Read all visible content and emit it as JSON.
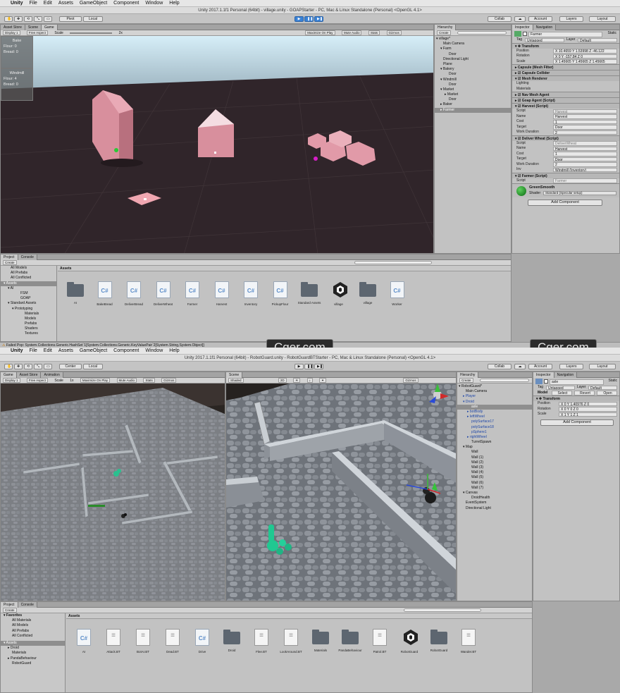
{
  "window1": {
    "menu": [
      "Unity",
      "File",
      "Edit",
      "Assets",
      "GameObject",
      "Component",
      "Window",
      "Help"
    ],
    "title": "Unity 2017.1.1f1 Personal (64bit) - village.unity - GOAPStarter - PC, Mac & Linux Standalone (Personal) <OpenGL 4.1>",
    "toolbar": {
      "pivot": "Pivot",
      "local": "Local",
      "collab": "Collab",
      "account": "Account",
      "layers": "Layers",
      "layout": "Layout"
    },
    "tabs_left": [
      "Asset Store",
      "Scene",
      "Game"
    ],
    "game_bar": [
      "Display 1",
      "Free Aspect",
      "Scale",
      "2x",
      "Maximize On Play",
      "Mute Audio",
      "Stats",
      "Gizmos"
    ],
    "overlay_bake": {
      "title": "Bake",
      "lines": [
        "Flour: 0",
        "Bread: 0"
      ]
    },
    "overlay_windmill": {
      "title": "Windmill",
      "lines": [
        "Flour: 4",
        "Bread: 0"
      ]
    },
    "hierarchy": {
      "tab": "Hierarchy",
      "create": "Create",
      "items": [
        "village*",
        "Main Camera",
        "Farm",
        "Door",
        "Directional Light",
        "Plane",
        "Bakery",
        "Door",
        "Windmill",
        "Door",
        "Market",
        "Market",
        "Door",
        "Baker",
        "Farmer"
      ]
    },
    "inspector": {
      "tabs": [
        "Inspector",
        "Navigation"
      ],
      "object_name": "Farmer",
      "static": "Static",
      "tag_label": "Tag",
      "tag": "Untagged",
      "layer_label": "Layer",
      "layer": "Default",
      "transform": {
        "header": "Transform",
        "rows": [
          {
            "k": "Position",
            "v": "X 10.4659   Y 1.53998   Z -46.122"
          },
          {
            "k": "Rotation",
            "v": "X 0   Y -157.84   Z 0"
          },
          {
            "k": "Scale",
            "v": "X 1.45665   Y 1.45665   Z 1.45665"
          }
        ]
      },
      "components": [
        "Capsule (Mesh Filter)",
        "Capsule Collider",
        "Mesh Renderer",
        "Lighting",
        "Materials",
        "Nav Mesh Agent",
        "Goap Agent (Script)"
      ],
      "harvest": {
        "header": "Harvest (Script)",
        "rows": [
          {
            "k": "Script",
            "v": "Harvest"
          },
          {
            "k": "Name",
            "v": "Harvest"
          },
          {
            "k": "Cost",
            "v": "1"
          },
          {
            "k": "Target",
            "v": "Door"
          },
          {
            "k": "Work Duration",
            "v": "2"
          }
        ]
      },
      "deliver": {
        "header": "Deliver Wheat (Script)",
        "rows": [
          {
            "k": "Script",
            "v": "DeliverWheat"
          },
          {
            "k": "Name",
            "v": "Harvest"
          },
          {
            "k": "Cost",
            "v": "1"
          },
          {
            "k": "Target",
            "v": "Door"
          },
          {
            "k": "Work Duration",
            "v": "2"
          },
          {
            "k": "Inv",
            "v": "Windmill (Inventory)"
          }
        ]
      },
      "farmer": {
        "header": "Farmer (Script)",
        "rows": [
          {
            "k": "Script",
            "v": "Farmer"
          }
        ]
      },
      "material": {
        "name": "GreenSmooth",
        "shader_label": "Shader",
        "shader": "Standard (Specular setup)"
      },
      "add_component": "Add Component"
    },
    "project": {
      "tabs": [
        "Project",
        "Console"
      ],
      "create": "Create",
      "tree": [
        "All Models",
        "All Prefabs",
        "All Conflicted",
        "Assets",
        "AI",
        "FSM",
        "GOAP",
        "Standard Assets",
        "Prototyping",
        "Materials",
        "Models",
        "Prefabs",
        "Shaders",
        "Textures"
      ],
      "breadcrumb": "Assets",
      "assets": [
        "AI",
        "BakeBread",
        "DeliverBread",
        "DeliverWheat",
        "Farmer",
        "Harvest",
        "Inventory",
        "PickupFlour",
        "Standard Assets",
        "village",
        "village",
        "Worker"
      ]
    },
    "status": "Failed Pop: System.Collections.Generic.HashSet`1[System.Collections.Generic.KeyValuePair`2[System.String,System.Object]]",
    "watermark": [
      "Cger.com",
      "Cger.com"
    ]
  },
  "window2": {
    "menu": [
      "Unity",
      "File",
      "Edit",
      "Assets",
      "GameObject",
      "Component",
      "Window",
      "Help"
    ],
    "title": "Unity 2017.1.1f1 Personal (64bit) - RobotGuard.unity - RobotGuardBTStarter - PC, Mac & Linux Standalone (Personal) <OpenGL 4.1>",
    "toolbar": {
      "pivot": "Center",
      "local": "Local",
      "collab": "Collab",
      "account": "Account",
      "layers": "Layers",
      "layout": "Layout"
    },
    "tabs_left": [
      "Game",
      "Asset Store",
      "Animation"
    ],
    "game_bar": [
      "Display 1",
      "Free Aspect",
      "Scale",
      "1x",
      "Maximize On Play",
      "Mute Audio",
      "Stats",
      "Gizmos"
    ],
    "scene_tab": "Scene",
    "scene_bar": [
      "Shaded",
      "2D",
      "Gizmos"
    ],
    "hierarchy": {
      "tab": "Hierarchy",
      "create": "Create",
      "items": [
        "RobotGuard*",
        "Main Camera",
        "Player",
        "Droid",
        "axle",
        "botBody",
        "leftWheel",
        "polySurface17",
        "polySurface18",
        "pSphere1",
        "rightWheel",
        "TurretSpawn",
        "Map",
        "Wall",
        "Wall (1)",
        "Wall (2)",
        "Wall (3)",
        "Wall (4)",
        "Wall (5)",
        "Wall (6)",
        "Wall (7)",
        "Canvas",
        "DroidHealth",
        "EventSystem",
        "Directional Light"
      ]
    },
    "inspector": {
      "tabs": [
        "Inspector",
        "Navigation"
      ],
      "object_name": "axle",
      "static": "Static",
      "tag_label": "Tag",
      "tag": "Untagged",
      "layer_label": "Layer",
      "layer": "Default",
      "model_label": "Model",
      "model_buttons": [
        "Select",
        "Revert",
        "Open"
      ],
      "transform": {
        "header": "Transform",
        "rows": [
          {
            "k": "Position",
            "v": "X 0   Y 1.40976   Z 0"
          },
          {
            "k": "Rotation",
            "v": "X 0   Y 0   Z 0"
          },
          {
            "k": "Scale",
            "v": "X 1   Y 1   Z 1"
          }
        ]
      },
      "add_component": "Add Component"
    },
    "project": {
      "tabs": [
        "Project",
        "Console"
      ],
      "create": "Create",
      "tree": [
        "Favorites",
        "All Materials",
        "All Models",
        "All Prefabs",
        "All Conflicted",
        "Assets",
        "Droid",
        "Materials",
        "PandaBehaviour",
        "RobotGuard"
      ],
      "breadcrumb": "Assets",
      "assets": [
        "AI",
        "Attack.BT",
        "BotAI.BT",
        "Dead.BT",
        "Drive",
        "Droid",
        "Flee.BT",
        "LookAround.BT",
        "Materials",
        "PandaBehaviour",
        "Patrol.BT",
        "RobotGuard",
        "RobotGuard",
        "Wander.BT"
      ]
    }
  }
}
